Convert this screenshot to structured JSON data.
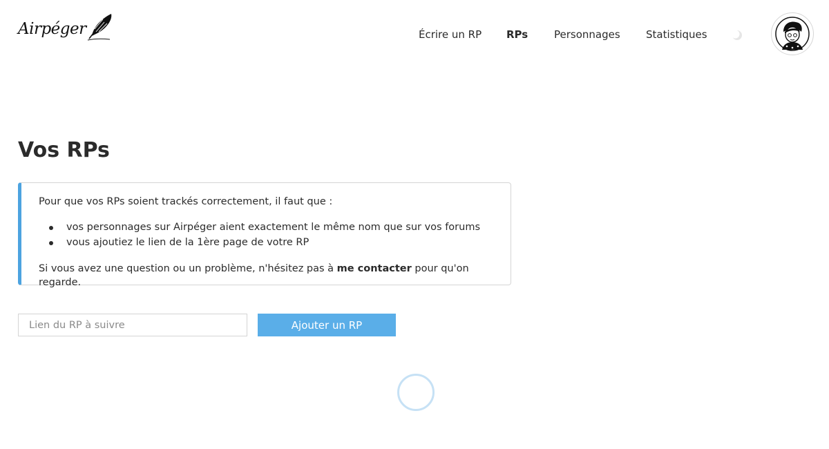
{
  "header": {
    "logo_text": "Airpéger",
    "nav": {
      "write": "Écrire un RP",
      "rps": "RPs",
      "characters": "Personnages",
      "statistics": "Statistiques"
    },
    "active_nav": "rps"
  },
  "main": {
    "title": "Vos RPs",
    "info": {
      "intro": "Pour que vos RPs soient trackés correctement, il faut que :",
      "bullets": [
        "vos personnages sur Airpéger aient exactement le même nom que sur vos forums",
        "vous ajoutiez le lien de la 1ère page de votre RP"
      ],
      "footer_before": "Si vous avez une question ou un problème, n'hésitez pas à ",
      "footer_link": "me contacter",
      "footer_after": " pour qu'on regarde."
    },
    "form": {
      "input_placeholder": "Lien du RP à suivre",
      "input_value": "",
      "button_label": "Ajouter un RP"
    }
  },
  "colors": {
    "accent": "#5aaee8",
    "info_border": "#4ca3e0",
    "spinner": "#c6e1f5"
  },
  "icons": {
    "logo": "feather-icon",
    "theme_toggle": "moon-icon",
    "avatar": "user-avatar",
    "loading": "spinner"
  }
}
